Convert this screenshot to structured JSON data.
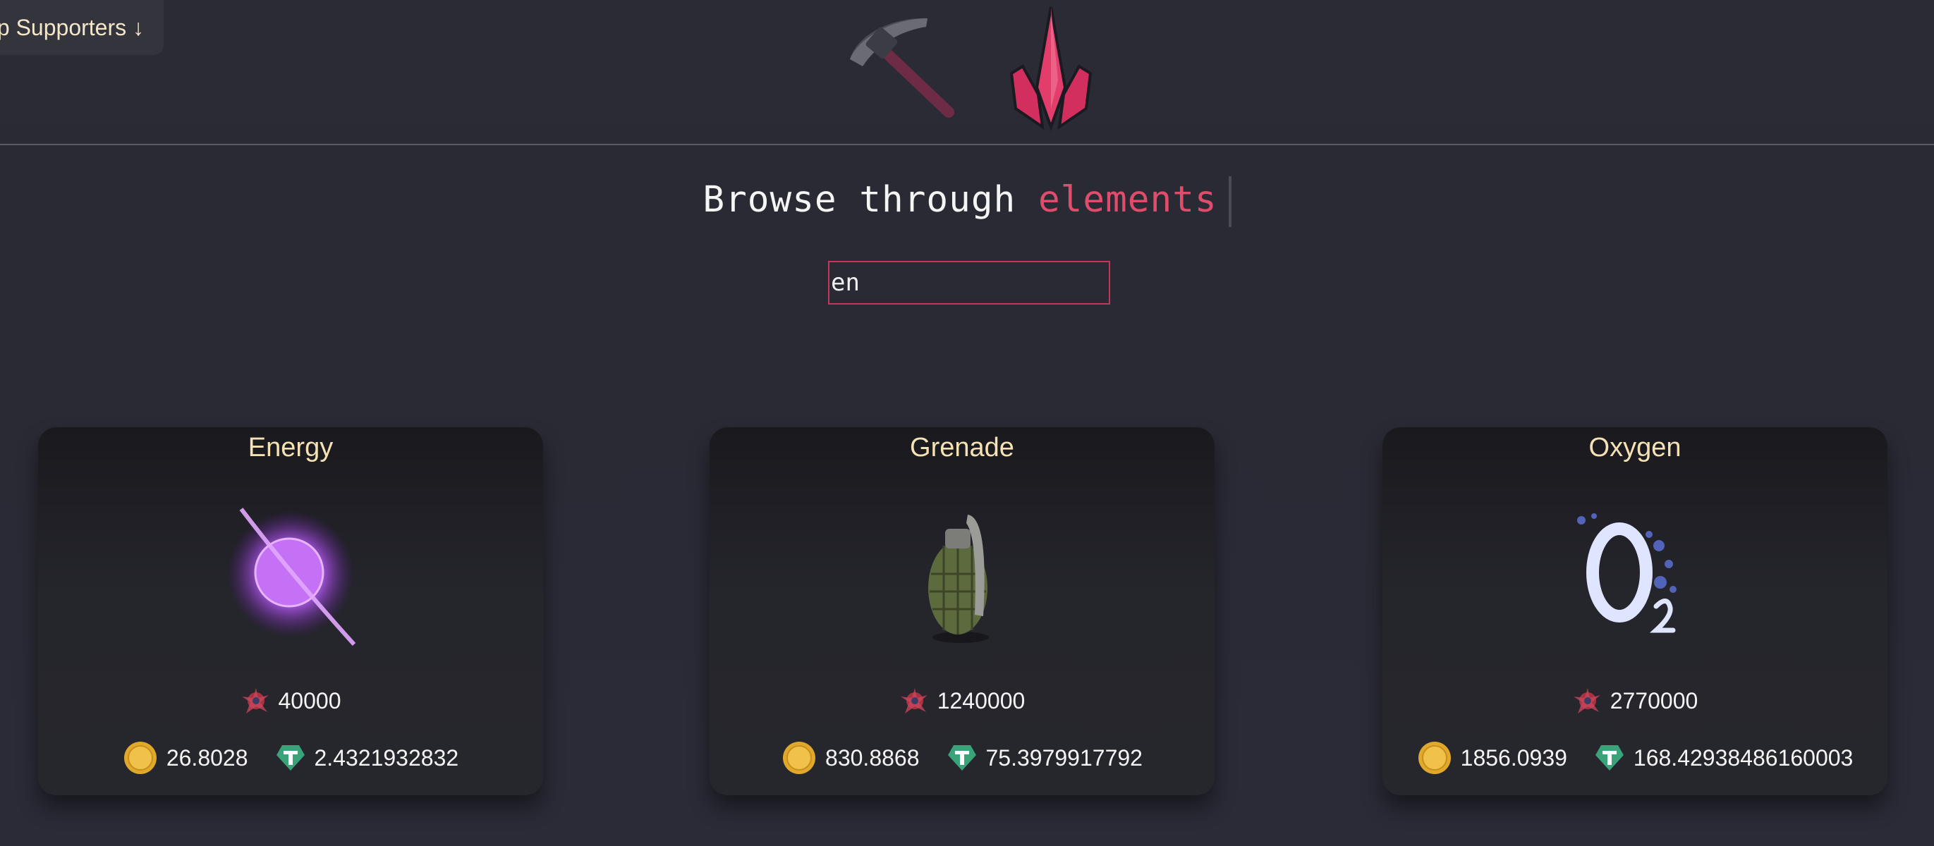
{
  "header": {
    "supporters_button": "p Supporters ↓"
  },
  "heading": {
    "prefix": "Browse through",
    "highlight": "elements"
  },
  "search": {
    "value": "en"
  },
  "colors": {
    "accent": "#e04d6c",
    "card_title": "#f4e1b4",
    "background": "#2a2a35"
  },
  "cards": [
    {
      "title": "Energy",
      "image": "energy-orb-icon",
      "mining_value": "40000",
      "coin_value": "26.8028",
      "token_value": "2.4321932832"
    },
    {
      "title": "Grenade",
      "image": "grenade-icon",
      "mining_value": "1240000",
      "coin_value": "830.8868",
      "token_value": "75.3979917792"
    },
    {
      "title": "Oxygen",
      "image": "oxygen-icon",
      "mining_value": "2770000",
      "coin_value": "1856.0939",
      "token_value": "168.42938486160003"
    }
  ]
}
